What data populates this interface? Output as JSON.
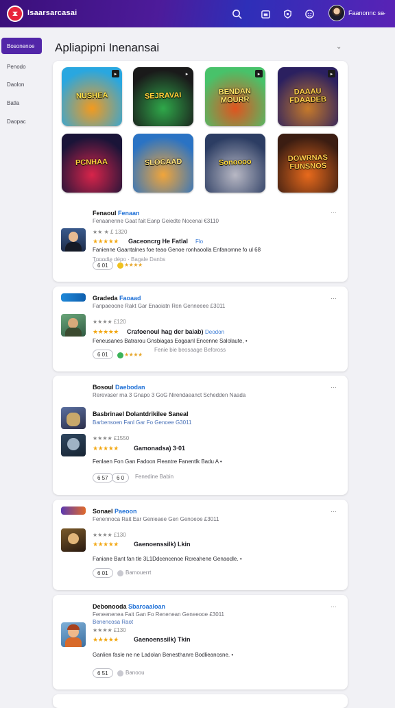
{
  "topbar": {
    "brand": "Isaarsarcasai",
    "user_name": "Faanonnc se",
    "caret": "⌄",
    "icons": [
      "search-icon",
      "calendar-icon",
      "shield-icon",
      "face-icon"
    ],
    "gradient_colors": [
      "#3a0f7a",
      "#2e2fb8",
      "#5a22b5"
    ]
  },
  "sidebar": {
    "active": "Bosonenoe",
    "items": [
      "Penodo",
      "Daolon",
      "Batla",
      "Daopac"
    ],
    "accent": "#5226a8"
  },
  "page": {
    "title": "Apliapipni Inenansai",
    "caret": "⌄"
  },
  "featured": [
    {
      "label": "NUSHEA",
      "colors": [
        "#29a7e0",
        "#f39a1e"
      ]
    },
    {
      "label": "SEJRAVAI",
      "colors": [
        "#1a1a1a",
        "#2fa84a"
      ]
    },
    {
      "label": "BENDAN\nMOURR",
      "colors": [
        "#48c26a",
        "#e0541f"
      ]
    },
    {
      "label": "DAAAU\nFDAADEB",
      "colors": [
        "#2b2060",
        "#c67a2a"
      ]
    },
    {
      "label": "PCNHAA",
      "colors": [
        "#1a1438",
        "#d8244a"
      ]
    },
    {
      "label": "SLOCAAD",
      "colors": [
        "#2a73c4",
        "#f1a53a"
      ]
    },
    {
      "label": "Sonoooo",
      "colors": [
        "#2c3d63",
        "#b8b8c4"
      ]
    },
    {
      "label": "DOWRNAS\nFUNSNOS",
      "colors": [
        "#3b1d12",
        "#e86a1c"
      ]
    }
  ],
  "apps": [
    {
      "name": "Fenaoul",
      "name_blue": "Fenaan",
      "subtitle": "Fenaanenne Gaat fait Eanp Geiedte Nocenai €3110",
      "meta": "★★ ★ £ 1320",
      "stars": "★★★★★",
      "rating_text": "Gaceoncrg He Fatlal",
      "rating_chip": "Flo",
      "desc": "Fanienne Gaantalnes foe teao Genoe ronhaoolla Enfanomne fo ul 68",
      "tags": "Tnnodie dépo · Bagale Danbs",
      "pill": "6 01",
      "small_stars": "★★★★",
      "more": "···"
    },
    {
      "name": "Gradeda",
      "name_blue": "Faoaad",
      "subtitle": "Fanpaeoone Rakt Gar Enaoiatn Ren Genneeee £3011",
      "meta": "★★★★ £120",
      "stars": "★★★★★",
      "rating_text": "Crafoenoul hag der baiab)",
      "rating_chip": "Deodon",
      "desc": "Feneusanes Batrarou Gnsbiagas Eogaanl Encenne Salolaute, •",
      "tags": "Fenie bie beosaage Befoross",
      "pill": "6 01",
      "small_stars": "★★★★",
      "more": "···"
    },
    {
      "name": "Bosoul",
      "name_blue": "Daebodan",
      "subtitle": "Rerevaser rna 3 Gnapo 3 GoG Nirendaeanct Schedden Naada",
      "featured_name": "Basbrinael Dolantdrikilee Saneal",
      "featured_sub": "Barbensoen Fanl Gar Fo Genoee G3011",
      "meta": "★★★★ £1550",
      "stars": "★★★★★",
      "rating_text": "Gamonadsa) 3·01",
      "desc": "Fenlaen Fon Gan Fadoon Fleantre Fanentlk Badu A •",
      "tags": "Fenedine Babin",
      "pills": [
        "6 57",
        "6 0"
      ],
      "more": "···"
    },
    {
      "name": "Sonael",
      "name_blue": "Paeoon",
      "subtitle": "Fenennoca Rait Ear Genieaee Gen Genoeoe £3011",
      "meta": "★★★★ £130",
      "stars": "★★★★★",
      "rating_text": "Gaenoenssilk) Lkin",
      "desc": "Faniane Bant fan tle 3L1Ddcencenoe Rcreahene Genaodle. •",
      "tags": "Bamouerrt",
      "pill": "6 01",
      "more": "···"
    },
    {
      "name": "Debonooda",
      "name_blue": "Sbaroaaloan",
      "subtitle": "Feneenenea Fait Gan Fo Renenean Geneeooe £3011",
      "sub2": "Benencosa Raot",
      "meta": "★★★★ £130",
      "stars": "★★★★★",
      "rating_text": "Gaenoenssilk) Tkin",
      "desc": "Ganlien fasle ne ne Ladolan Benesthanre Bodlieanosne. •",
      "tags": "Banoou",
      "pill": "6 51",
      "more": "···"
    }
  ]
}
